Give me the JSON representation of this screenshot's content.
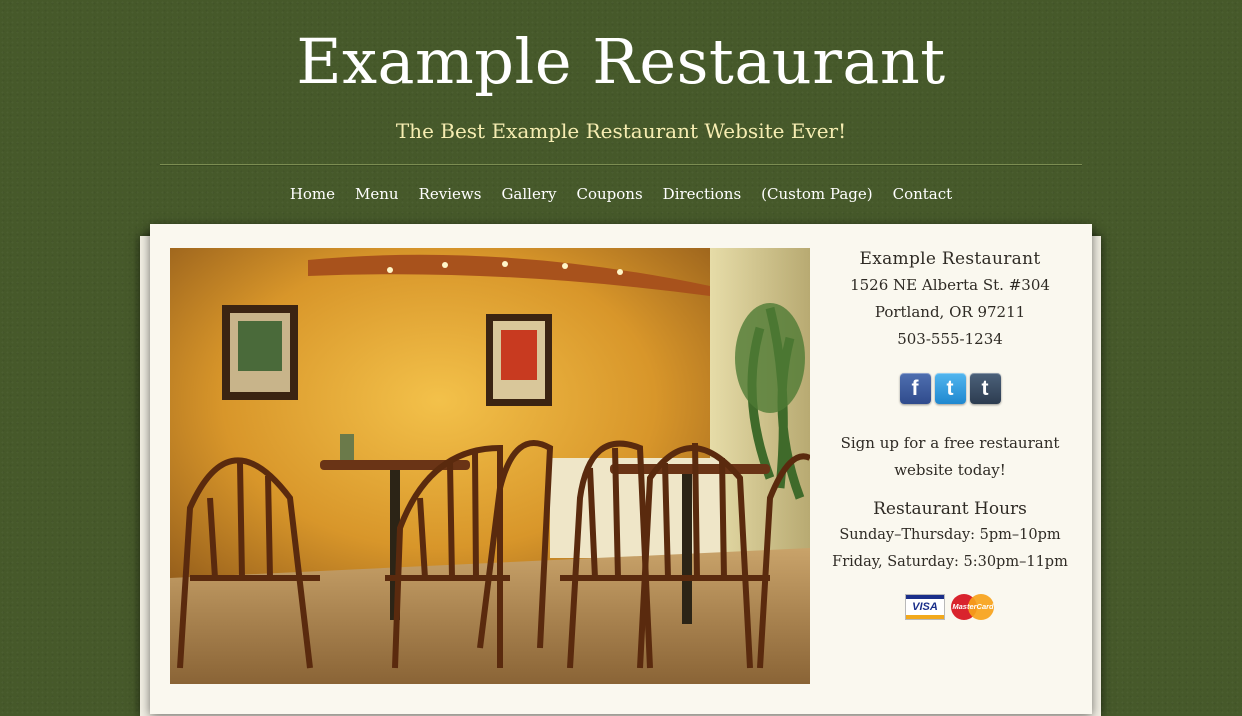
{
  "header": {
    "title": "Example Restaurant",
    "tagline": "The Best Example Restaurant Website Ever!"
  },
  "nav": {
    "items": [
      {
        "label": "Home"
      },
      {
        "label": "Menu"
      },
      {
        "label": "Reviews"
      },
      {
        "label": "Gallery"
      },
      {
        "label": "Coupons"
      },
      {
        "label": "Directions"
      },
      {
        "label": "(Custom Page)"
      },
      {
        "label": "Contact"
      }
    ]
  },
  "sidebar": {
    "name": "Example Restaurant",
    "address_line1": "1526 NE Alberta St. #304",
    "address_line2": "Portland, OR 97211",
    "phone": "503-555-1234",
    "social": [
      {
        "icon": "facebook-icon",
        "glyph": "f"
      },
      {
        "icon": "twitter-icon",
        "glyph": "t"
      },
      {
        "icon": "tumblr-icon",
        "glyph": "t"
      }
    ],
    "signup_line1": "Sign up for a free restaurant",
    "signup_line2": "website today!",
    "hours_title": "Restaurant Hours",
    "hours": [
      "Sunday–Thursday: 5pm–10pm",
      "Friday, Saturday: 5:30pm–11pm"
    ],
    "cards": {
      "visa": "VISA",
      "mastercard": "MasterCard"
    }
  },
  "colors": {
    "background": "#46592a",
    "tagline": "#f6edb2",
    "panel": "#faf8ef"
  }
}
